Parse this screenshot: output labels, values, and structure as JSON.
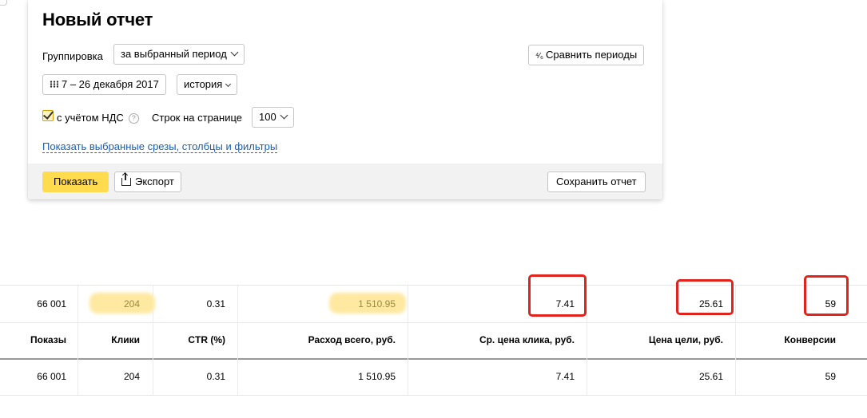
{
  "panel": {
    "title": "Новый отчет",
    "grouping_label": "Группировка",
    "grouping_value": "за выбранный период",
    "compare_button": "Сравнить периоды",
    "date_range": "7 – 26 декабря 2017",
    "history": "история",
    "vat_label": "с учётом НДС",
    "vat_checked": true,
    "rows_label": "Строк на странице",
    "rows_value": "100",
    "show_slices_link": "Показать выбранные срезы, столбцы и фильтры",
    "show_button": "Показать",
    "export_button": "Экспорт",
    "save_button": "Сохранить отчет"
  },
  "table": {
    "totals": [
      "66 001",
      "204",
      "0.31",
      "1 510.95",
      "7.41",
      "25.61",
      "59"
    ],
    "headers": [
      "Показы",
      "Клики",
      "CTR (%)",
      "Расход всего, руб.",
      "Ср. цена клика, руб.",
      "Цена цели, руб.",
      "Конверсии"
    ],
    "rows": [
      [
        "66 001",
        "204",
        "0.31",
        "1 510.95",
        "7.41",
        "25.61",
        "59"
      ]
    ]
  },
  "colors": {
    "accent_yellow": "#ffdb4d",
    "link_blue": "#1a5fb4",
    "highlight_red": "#e0241b",
    "highlight_yellow": "#ffe8a0"
  }
}
